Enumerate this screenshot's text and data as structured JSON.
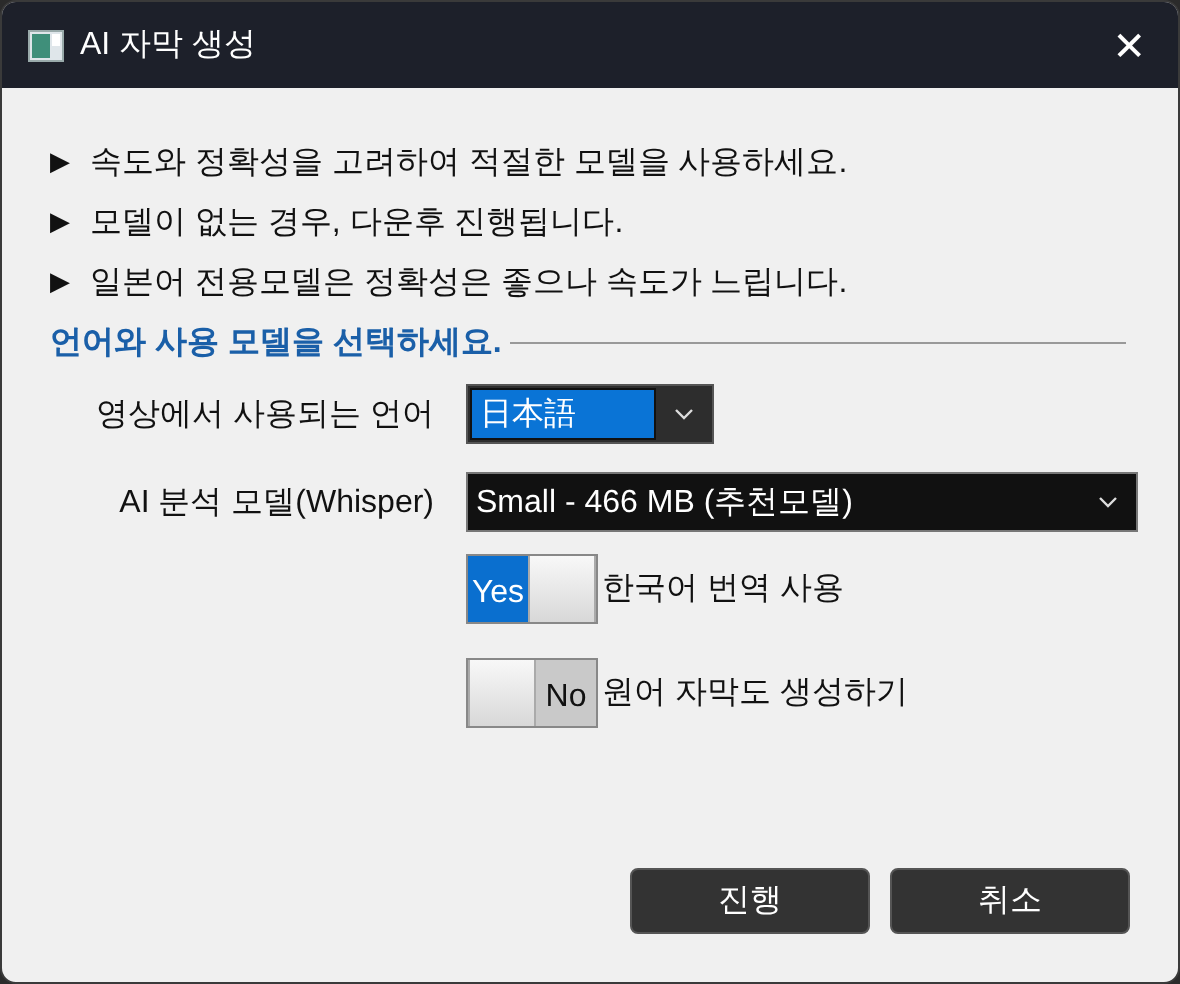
{
  "window": {
    "title": "AI 자막 생성",
    "close": "✕"
  },
  "notes": [
    {
      "marker": "▶",
      "text": "속도와 정확성을 고려하여 적절한 모델을 사용하세요."
    },
    {
      "marker": "▶",
      "text": "모델이 없는 경우, 다운후 진행됩니다."
    },
    {
      "marker": "▶",
      "text": "일본어 전용모델은 정확성은 좋으나 속도가 느립니다."
    }
  ],
  "section": {
    "title": "언어와 사용 모델을 선택하세요."
  },
  "fields": [
    {
      "label": "영상에서 사용되는 언어",
      "value": "日本語",
      "focused": true
    },
    {
      "label": "AI 분석 모델(Whisper)",
      "value": "Small - 466 MB (추천모델)",
      "focused": false
    }
  ],
  "toggles": [
    {
      "state_text": "Yes",
      "on": true,
      "label": "한국어 번역 사용"
    },
    {
      "state_text": "No",
      "on": false,
      "label": "원어 자막도 생성하기"
    }
  ],
  "buttons": [
    "진행",
    "취소"
  ]
}
